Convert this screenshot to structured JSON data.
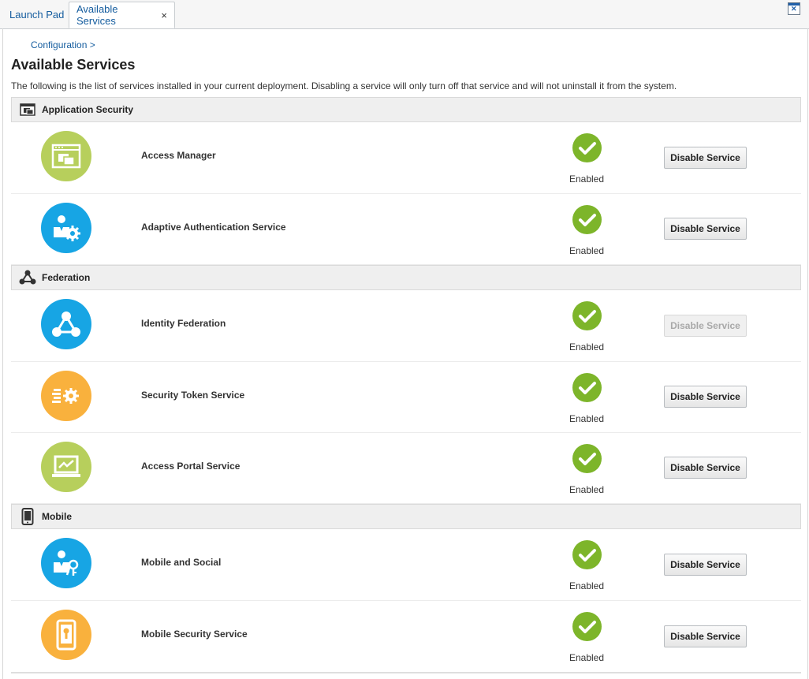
{
  "tabs": [
    {
      "label": "Launch Pad"
    },
    {
      "label": "Available Services",
      "close": "×"
    }
  ],
  "breadcrumb": "Configuration >",
  "title": "Available Services",
  "description": "The following is the list of services installed in your current deployment. Disabling a service will only turn off that service and will not uninstall it from the system.",
  "sections": [
    {
      "label": "Application Security",
      "icon": "windows-icon"
    },
    {
      "label": "Federation",
      "icon": "network-icon"
    },
    {
      "label": "Mobile",
      "icon": "mobile-icon"
    }
  ],
  "services": [
    {
      "name": "Access Manager",
      "status": "Enabled",
      "button": "Disable Service",
      "button_enabled": true,
      "icon": "access-manager-icon",
      "color": "#b7cf5c"
    },
    {
      "name": "Adaptive Authentication Service",
      "status": "Enabled",
      "button": "Disable Service",
      "button_enabled": true,
      "icon": "user-gear-icon",
      "color": "#17a5e4"
    },
    {
      "name": "Identity Federation",
      "status": "Enabled",
      "button": "Disable Service",
      "button_enabled": false,
      "icon": "federation-icon",
      "color": "#17a5e4"
    },
    {
      "name": "Security Token Service",
      "status": "Enabled",
      "button": "Disable Service",
      "button_enabled": true,
      "icon": "token-gear-icon",
      "color": "#f9b13d"
    },
    {
      "name": "Access Portal Service",
      "status": "Enabled",
      "button": "Disable Service",
      "button_enabled": true,
      "icon": "laptop-icon",
      "color": "#b7cf5c"
    },
    {
      "name": "Mobile and Social",
      "status": "Enabled",
      "button": "Disable Service",
      "button_enabled": true,
      "icon": "user-key-icon",
      "color": "#17a5e4"
    },
    {
      "name": "Mobile Security Service",
      "status": "Enabled",
      "button": "Disable Service",
      "button_enabled": true,
      "icon": "phone-lock-icon",
      "color": "#f9b13d"
    }
  ]
}
